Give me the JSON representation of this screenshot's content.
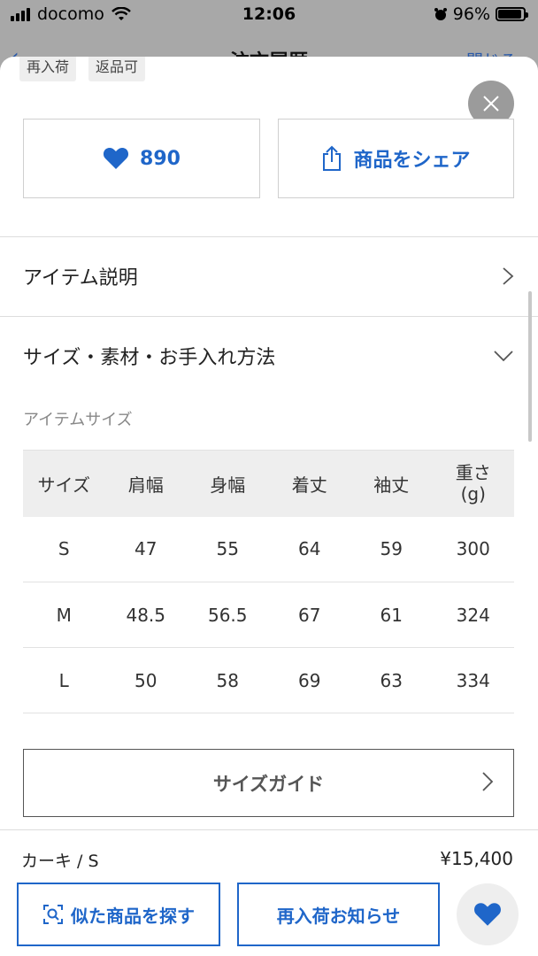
{
  "status_bar": {
    "carrier": "docomo",
    "time": "12:06",
    "battery": "96%"
  },
  "underlying_nav": {
    "title": "注文履歴",
    "close_label": "閉じる"
  },
  "tags": [
    "再入荷",
    "返品可"
  ],
  "actions": {
    "like_count": "890",
    "share_label": "商品をシェア"
  },
  "sections": {
    "item_description": "アイテム説明",
    "size_material": "サイズ・素材・お手入れ方法",
    "item_size_heading": "アイテムサイズ"
  },
  "size_table": {
    "headers": [
      "サイズ",
      "肩幅",
      "身幅",
      "着丈",
      "袖丈",
      "重さ\n(g)"
    ],
    "rows": [
      [
        "S",
        "47",
        "55",
        "64",
        "59",
        "300"
      ],
      [
        "M",
        "48.5",
        "56.5",
        "67",
        "61",
        "324"
      ],
      [
        "L",
        "50",
        "58",
        "69",
        "63",
        "334"
      ]
    ]
  },
  "size_guide_label": "サイズガイド",
  "bottom_bar": {
    "variant": "カーキ / S",
    "price": "¥15,400",
    "similar_label": "似た商品を探す",
    "restock_label": "再入荷お知らせ"
  },
  "colors": {
    "accent": "#1f66c9",
    "close_circle": "#9b9b9b"
  }
}
